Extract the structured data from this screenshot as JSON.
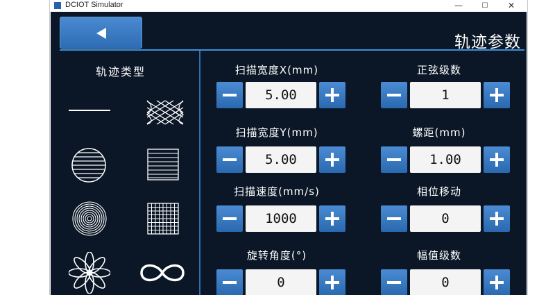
{
  "window": {
    "title": "DCIOT Simulator",
    "controls": {
      "minimize": "—",
      "maximize": "☐",
      "close": "✕"
    }
  },
  "header": {
    "title": "轨迹参数",
    "back_icon": "left-arrow-icon"
  },
  "trajectory_panel": {
    "title": "轨迹类型",
    "types": [
      {
        "name": "line",
        "icon": "line-trajectory-icon"
      },
      {
        "name": "cross-hatch",
        "icon": "crosshatch-trajectory-icon"
      },
      {
        "name": "circle-lines",
        "icon": "circle-lines-trajectory-icon"
      },
      {
        "name": "square-lines",
        "icon": "square-lines-trajectory-icon"
      },
      {
        "name": "spiral",
        "icon": "spiral-trajectory-icon"
      },
      {
        "name": "grid",
        "icon": "grid-trajectory-icon"
      },
      {
        "name": "flower",
        "icon": "flower-trajectory-icon"
      },
      {
        "name": "infinity",
        "icon": "infinity-trajectory-icon"
      }
    ]
  },
  "params": [
    {
      "label": "扫描宽度X(mm)",
      "value": "5.00"
    },
    {
      "label": "正弦级数",
      "value": "1"
    },
    {
      "label": "扫描宽度Y(mm)",
      "value": "5.00"
    },
    {
      "label": "螺距(mm)",
      "value": "1.00"
    },
    {
      "label": "扫描速度(mm/s)",
      "value": "1000"
    },
    {
      "label": "相位移动",
      "value": "0"
    },
    {
      "label": "旋转角度(°)",
      "value": "0"
    },
    {
      "label": "幅值级数",
      "value": "0"
    }
  ],
  "colors": {
    "background": "#0b1726",
    "accent": "#3c8fd8",
    "button": "#2e6db3",
    "value_field": "#f4f4f4"
  }
}
